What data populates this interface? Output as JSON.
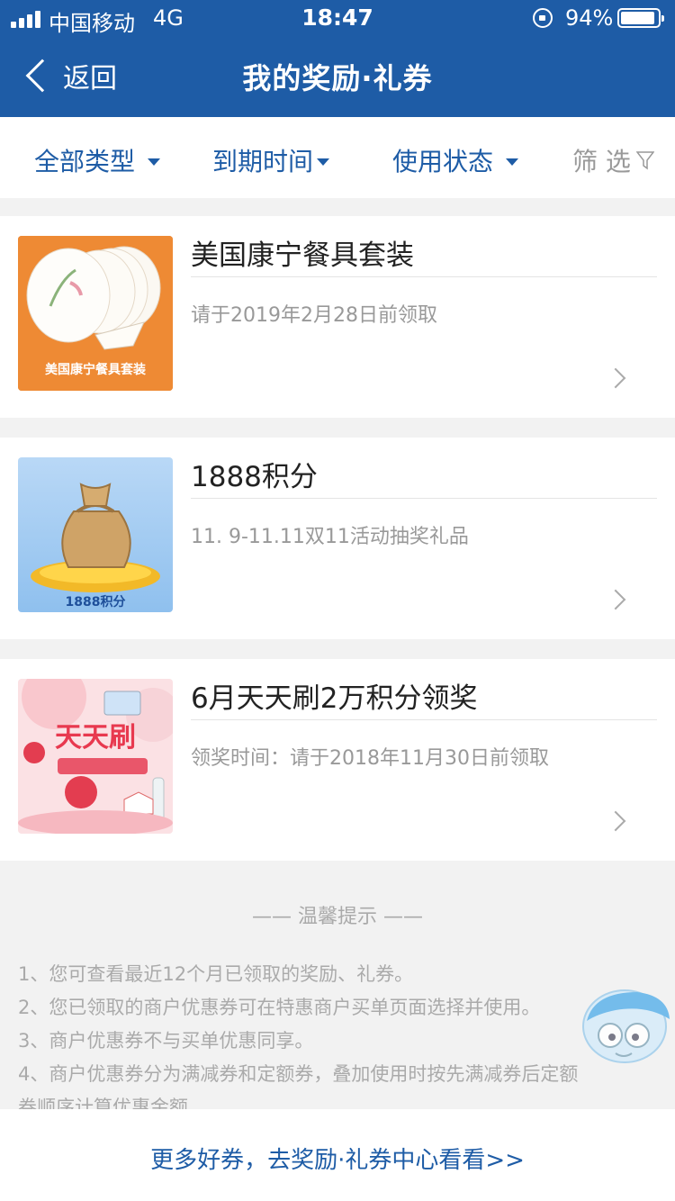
{
  "status_bar": {
    "carrier": "中国移动",
    "network": "4G",
    "time": "18:47",
    "battery_percent": "94%",
    "battery_level": 0.94
  },
  "nav": {
    "back_label": "返回",
    "title": "我的奖励·礼券"
  },
  "filters": {
    "all_types": "全部类型",
    "expiry": "到期时间",
    "usage_status": "使用状态",
    "screen": "筛 选"
  },
  "rewards": [
    {
      "title": "美国康宁餐具套装",
      "subtitle": "请于2019年2月28日前领取",
      "thumb_text": "美国康宁餐具套装"
    },
    {
      "title": "1888积分",
      "subtitle": "11. 9-11.11双11活动抽奖礼品",
      "thumb_text": "1888积分"
    },
    {
      "title": "6月天天刷2万积分领奖",
      "subtitle": "领奖时间：请于2018年11月30日前领取",
      "thumb_text": "天天刷"
    }
  ],
  "tips": {
    "title": "—— 温馨提示 ——",
    "lines": [
      "1、您可查看最近12个月已领取的奖励、礼券。",
      "2、您已领取的商户优惠券可在特惠商户买单页面选择并使用。",
      "3、商户优惠券不与买单优惠同享。",
      "4、商户优惠券分为满减券和定额券，叠加使用时按先满减券后定额",
      "券顺序计算优惠金额"
    ]
  },
  "bottom_link": "更多好券，去奖励·礼券中心看看>>",
  "colors": {
    "brand_blue": "#1e5ca6",
    "background": "#f2f2f2",
    "muted_text": "#999999"
  }
}
